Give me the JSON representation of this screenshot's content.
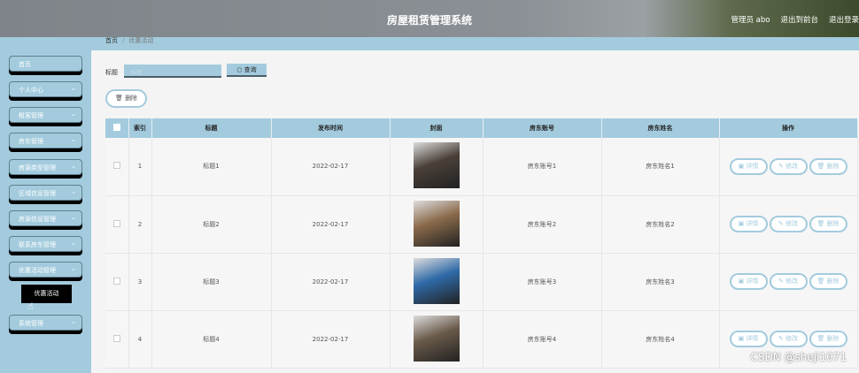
{
  "header": {
    "title": "房屋租赁管理系统",
    "user": "管理员 abo",
    "to_front": "退出到前台",
    "logout": "退出登录"
  },
  "sidebar": {
    "items": [
      "首页",
      "个人中心",
      "租客管理",
      "房东管理",
      "房源类型管理",
      "区域信息管理",
      "房源信息管理",
      "联系房东管理",
      "优惠活动管理",
      "系统管理"
    ],
    "submenu": "优惠活动"
  },
  "breadcrumb": {
    "home": "首页",
    "sep": "/",
    "current": "优惠活动"
  },
  "search": {
    "label": "标题",
    "placeholder": "标题",
    "button": "查询"
  },
  "toolbar": {
    "delete": "删除"
  },
  "table": {
    "headers": [
      "索引",
      "标题",
      "发布时间",
      "封面",
      "房东账号",
      "房东姓名",
      "操作"
    ],
    "rows": [
      {
        "index": "1",
        "title": "标题1",
        "date": "2022-02-17",
        "account": "房东账号1",
        "name": "房东姓名1",
        "cover": "#4a4038"
      },
      {
        "index": "2",
        "title": "标题2",
        "date": "2022-02-17",
        "account": "房东账号2",
        "name": "房东姓名2",
        "cover": "#8a6a4a"
      },
      {
        "index": "3",
        "title": "标题3",
        "date": "2022-02-17",
        "account": "房东账号3",
        "name": "房东姓名3",
        "cover": "#2f6aa8"
      },
      {
        "index": "4",
        "title": "标题4",
        "date": "2022-02-17",
        "account": "房东账号4",
        "name": "房东姓名4",
        "cover": "#6a5a4a"
      }
    ],
    "actions": {
      "detail": "详情",
      "edit": "修改",
      "delete": "删除"
    }
  },
  "watermark": "CSDN @sheji1071"
}
